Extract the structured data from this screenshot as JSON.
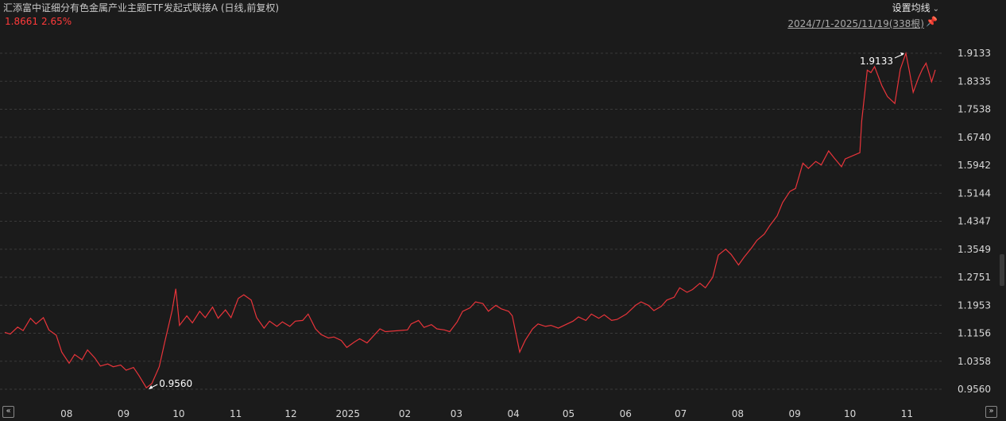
{
  "header": {
    "title": "汇添富中证细分有色金属产业主题ETF发起式联接A (日线,前复权)",
    "price": "1.8661",
    "change_pct": "2.65%",
    "settings_label": "设置均线",
    "date_range": "2024/7/1-2025/11/19(338根)"
  },
  "colors": {
    "line": "#e8343a",
    "price": "#ff3a3a",
    "grid": "#3a3a3a",
    "axis_text": "#d8d8d8"
  },
  "chart_data": {
    "type": "line",
    "title": "汇添富中证细分有色金属产业主题ETF发起式联接A (日线,前复权)",
    "xlabel": "",
    "ylabel": "",
    "x_tick_labels": [
      "08",
      "09",
      "10",
      "11",
      "12",
      "2025",
      "02",
      "03",
      "04",
      "05",
      "06",
      "07",
      "08",
      "09",
      "10",
      "11"
    ],
    "y_tick_labels": [
      "1.9133",
      "1.8335",
      "1.7538",
      "1.6740",
      "1.5942",
      "1.5144",
      "1.4347",
      "1.3549",
      "1.2751",
      "1.1953",
      "1.1156",
      "1.0358",
      "0.9560"
    ],
    "ylim": [
      0.956,
      1.9133
    ],
    "grid": true,
    "annotations": [
      {
        "label": "0.9560",
        "x": "2024-09-16",
        "y": 0.956,
        "kind": "low"
      },
      {
        "label": "1.9133",
        "x": "2025-11-03",
        "y": 1.9133,
        "kind": "high"
      }
    ],
    "series": [
      {
        "points": [
          [
            "2024-07-01",
            1.118
          ],
          [
            "2024-07-04",
            1.113
          ],
          [
            "2024-07-08",
            1.133
          ],
          [
            "2024-07-11",
            1.123
          ],
          [
            "2024-07-15",
            1.158
          ],
          [
            "2024-07-18",
            1.142
          ],
          [
            "2024-07-22",
            1.16
          ],
          [
            "2024-07-25",
            1.125
          ],
          [
            "2024-07-29",
            1.11
          ],
          [
            "2024-08-01",
            1.062
          ],
          [
            "2024-08-05",
            1.03
          ],
          [
            "2024-08-08",
            1.055
          ],
          [
            "2024-08-12",
            1.04
          ],
          [
            "2024-08-15",
            1.068
          ],
          [
            "2024-08-19",
            1.045
          ],
          [
            "2024-08-22",
            1.022
          ],
          [
            "2024-08-26",
            1.028
          ],
          [
            "2024-08-29",
            1.02
          ],
          [
            "2024-09-02",
            1.025
          ],
          [
            "2024-09-05",
            1.01
          ],
          [
            "2024-09-09",
            1.018
          ],
          [
            "2024-09-12",
            0.995
          ],
          [
            "2024-09-16",
            0.96
          ],
          [
            "2024-09-19",
            0.972
          ],
          [
            "2024-09-23",
            1.02
          ],
          [
            "2024-09-26",
            1.09
          ],
          [
            "2024-09-30",
            1.18
          ],
          [
            "2024-10-02",
            1.242
          ],
          [
            "2024-10-04",
            1.138
          ],
          [
            "2024-10-08",
            1.165
          ],
          [
            "2024-10-11",
            1.145
          ],
          [
            "2024-10-15",
            1.178
          ],
          [
            "2024-10-18",
            1.16
          ],
          [
            "2024-10-22",
            1.19
          ],
          [
            "2024-10-25",
            1.158
          ],
          [
            "2024-10-29",
            1.182
          ],
          [
            "2024-11-01",
            1.16
          ],
          [
            "2024-11-05",
            1.215
          ],
          [
            "2024-11-08",
            1.225
          ],
          [
            "2024-11-12",
            1.21
          ],
          [
            "2024-11-15",
            1.16
          ],
          [
            "2024-11-19",
            1.13
          ],
          [
            "2024-11-22",
            1.15
          ],
          [
            "2024-11-26",
            1.135
          ],
          [
            "2024-11-29",
            1.148
          ],
          [
            "2024-12-03",
            1.135
          ],
          [
            "2024-12-06",
            1.15
          ],
          [
            "2024-12-10",
            1.152
          ],
          [
            "2024-12-13",
            1.17
          ],
          [
            "2024-12-17",
            1.128
          ],
          [
            "2024-12-20",
            1.112
          ],
          [
            "2024-12-24",
            1.102
          ],
          [
            "2024-12-27",
            1.105
          ],
          [
            "2024-12-31",
            1.095
          ],
          [
            "2025-01-03",
            1.075
          ],
          [
            "2025-01-07",
            1.09
          ],
          [
            "2025-01-10",
            1.1
          ],
          [
            "2025-01-14",
            1.088
          ],
          [
            "2025-01-17",
            1.105
          ],
          [
            "2025-01-21",
            1.128
          ],
          [
            "2025-01-24",
            1.12
          ],
          [
            "2025-02-05",
            1.125
          ],
          [
            "2025-02-07",
            1.142
          ],
          [
            "2025-02-11",
            1.152
          ],
          [
            "2025-02-14",
            1.132
          ],
          [
            "2025-02-18",
            1.14
          ],
          [
            "2025-02-21",
            1.128
          ],
          [
            "2025-02-25",
            1.125
          ],
          [
            "2025-02-28",
            1.12
          ],
          [
            "2025-03-04",
            1.148
          ],
          [
            "2025-03-07",
            1.178
          ],
          [
            "2025-03-11",
            1.188
          ],
          [
            "2025-03-14",
            1.205
          ],
          [
            "2025-03-18",
            1.2
          ],
          [
            "2025-03-21",
            1.178
          ],
          [
            "2025-03-25",
            1.195
          ],
          [
            "2025-03-28",
            1.185
          ],
          [
            "2025-04-01",
            1.178
          ],
          [
            "2025-04-03",
            1.165
          ],
          [
            "2025-04-07",
            1.062
          ],
          [
            "2025-04-10",
            1.095
          ],
          [
            "2025-04-14",
            1.128
          ],
          [
            "2025-04-17",
            1.142
          ],
          [
            "2025-04-21",
            1.135
          ],
          [
            "2025-04-24",
            1.138
          ],
          [
            "2025-04-28",
            1.13
          ],
          [
            "2025-05-06",
            1.15
          ],
          [
            "2025-05-09",
            1.162
          ],
          [
            "2025-05-13",
            1.152
          ],
          [
            "2025-05-16",
            1.17
          ],
          [
            "2025-05-20",
            1.158
          ],
          [
            "2025-05-23",
            1.168
          ],
          [
            "2025-05-27",
            1.152
          ],
          [
            "2025-05-30",
            1.155
          ],
          [
            "2025-06-04",
            1.17
          ],
          [
            "2025-06-09",
            1.195
          ],
          [
            "2025-06-12",
            1.205
          ],
          [
            "2025-06-16",
            1.195
          ],
          [
            "2025-06-19",
            1.18
          ],
          [
            "2025-06-23",
            1.192
          ],
          [
            "2025-06-26",
            1.21
          ],
          [
            "2025-06-30",
            1.218
          ],
          [
            "2025-07-03",
            1.245
          ],
          [
            "2025-07-07",
            1.232
          ],
          [
            "2025-07-10",
            1.24
          ],
          [
            "2025-07-14",
            1.258
          ],
          [
            "2025-07-17",
            1.245
          ],
          [
            "2025-07-21",
            1.275
          ],
          [
            "2025-07-24",
            1.338
          ],
          [
            "2025-07-28",
            1.355
          ],
          [
            "2025-07-31",
            1.34
          ],
          [
            "2025-08-04",
            1.31
          ],
          [
            "2025-08-07",
            1.332
          ],
          [
            "2025-08-11",
            1.358
          ],
          [
            "2025-08-14",
            1.38
          ],
          [
            "2025-08-18",
            1.398
          ],
          [
            "2025-08-21",
            1.422
          ],
          [
            "2025-08-25",
            1.45
          ],
          [
            "2025-08-28",
            1.488
          ],
          [
            "2025-09-01",
            1.52
          ],
          [
            "2025-09-04",
            1.528
          ],
          [
            "2025-09-08",
            1.6
          ],
          [
            "2025-09-11",
            1.585
          ],
          [
            "2025-09-15",
            1.605
          ],
          [
            "2025-09-18",
            1.595
          ],
          [
            "2025-09-22",
            1.635
          ],
          [
            "2025-09-25",
            1.615
          ],
          [
            "2025-09-29",
            1.59
          ],
          [
            "2025-10-01",
            1.612
          ],
          [
            "2025-10-09",
            1.63
          ],
          [
            "2025-10-10",
            1.72
          ],
          [
            "2025-10-13",
            1.865
          ],
          [
            "2025-10-15",
            1.858
          ],
          [
            "2025-10-17",
            1.875
          ],
          [
            "2025-10-21",
            1.82
          ],
          [
            "2025-10-24",
            1.79
          ],
          [
            "2025-10-28",
            1.77
          ],
          [
            "2025-10-31",
            1.868
          ],
          [
            "2025-11-03",
            1.913
          ],
          [
            "2025-11-05",
            1.86
          ],
          [
            "2025-11-07",
            1.802
          ],
          [
            "2025-11-10",
            1.845
          ],
          [
            "2025-11-12",
            1.868
          ],
          [
            "2025-11-14",
            1.885
          ],
          [
            "2025-11-17",
            1.832
          ],
          [
            "2025-11-19",
            1.866
          ]
        ]
      }
    ]
  }
}
